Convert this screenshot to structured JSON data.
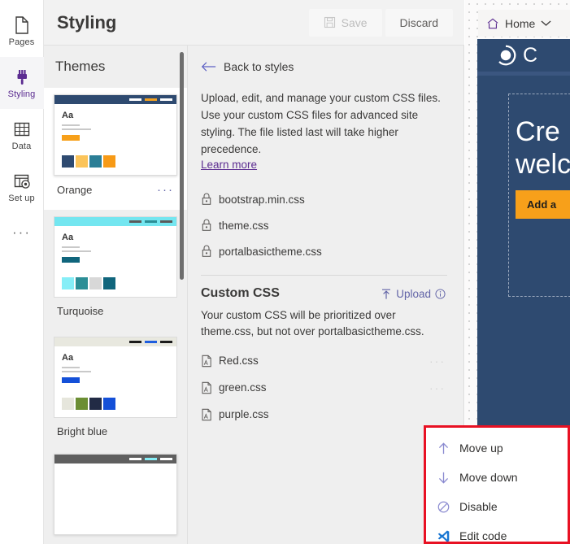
{
  "rail": {
    "items": [
      {
        "label": "Pages",
        "icon": "page-icon",
        "active": false
      },
      {
        "label": "Styling",
        "icon": "paintbrush-icon",
        "active": true
      },
      {
        "label": "Data",
        "icon": "table-icon",
        "active": false
      },
      {
        "label": "Set up",
        "icon": "setup-icon",
        "active": false
      }
    ],
    "overflow": "···"
  },
  "header": {
    "title": "Styling",
    "save_label": "Save",
    "save_icon": "save-disk-icon",
    "save_disabled": true,
    "discard_label": "Discard"
  },
  "themes": {
    "heading": "Themes",
    "scrollbar": true,
    "cards": [
      {
        "name": "Orange",
        "selected": true,
        "bar": "#2e4a70",
        "navlines": [
          "#ffffff",
          "#f2a122",
          "#ffffff"
        ],
        "button": "#f7a01a",
        "swatches": [
          "#2e4a70",
          "#fbc45a",
          "#2b7e96",
          "#f79a16"
        ],
        "ellipsis": "···"
      },
      {
        "name": "Turquoise",
        "selected": false,
        "bar": "#74e6f0",
        "navlines": [
          "#5a5a5a",
          "#2b8e96",
          "#5a5a5a"
        ],
        "button": "#10657c",
        "swatches": [
          "#86eef7",
          "#2b8e96",
          "#d8d8d8",
          "#10657c"
        ],
        "ellipsis": "···"
      },
      {
        "name": "Bright blue",
        "selected": false,
        "bar": "#e8e8df",
        "navlines": [
          "#1b1b1b",
          "#1f5ede",
          "#1b1b1b"
        ],
        "button": "#1450d8",
        "swatches": [
          "#e6e6dc",
          "#6b8e33",
          "#222b45",
          "#1450d8"
        ],
        "ellipsis": "···"
      },
      {
        "name": "",
        "selected": false,
        "bar": "#5f5f5f",
        "navlines": [
          "#ffffff",
          "#86eef7",
          "#ffffff"
        ],
        "button": "#5f5f5f",
        "swatches": [
          "#5f5f5f",
          "#86eef7",
          "#d8d8d8",
          "#333333"
        ],
        "ellipsis": "···"
      }
    ]
  },
  "detail": {
    "back_label": "Back to styles",
    "back_icon": "arrow-left-icon",
    "description": "Upload, edit, and manage your custom CSS files. Use your custom CSS files for advanced site styling. The file listed last will take higher precedence.",
    "learn_more": "Learn more",
    "theme_files": [
      {
        "name": "bootstrap.min.css",
        "icon": "lock-icon"
      },
      {
        "name": "theme.css",
        "icon": "lock-icon"
      },
      {
        "name": "portalbasictheme.css",
        "icon": "lock-icon"
      }
    ],
    "custom_section": {
      "title": "Custom CSS",
      "upload_label": "Upload",
      "upload_icon": "upload-arrow-icon",
      "info_icon": "info-circle-icon",
      "description": "Your custom CSS will be prioritized over theme.css, but not over portalbasictheme.css.",
      "files": [
        {
          "name": "Red.css",
          "icon": "css-file-icon",
          "ellipsis": "···"
        },
        {
          "name": "green.css",
          "icon": "css-file-icon",
          "ellipsis": "···"
        },
        {
          "name": "purple.css",
          "icon": "css-file-icon",
          "ellipsis": ""
        }
      ]
    }
  },
  "preview": {
    "home_label": "Home",
    "home_icon": "house-icon",
    "chevron_icon": "chevron-down-icon",
    "brand_icon": "site-logo-icon",
    "brand_text": "C",
    "hero_line1": "Cre",
    "hero_line2": "welc",
    "hero_button": "Add a",
    "site_bg": "#2e4a70",
    "hero_button_color": "#f7a01a"
  },
  "context_menu": {
    "highlight_color": "#e81123",
    "items": [
      {
        "label": "Move up",
        "icon": "arrow-up-icon"
      },
      {
        "label": "Move down",
        "icon": "arrow-down-icon"
      },
      {
        "label": "Disable",
        "icon": "block-circle-icon"
      },
      {
        "label": "Edit code",
        "icon": "vscode-icon"
      }
    ]
  }
}
